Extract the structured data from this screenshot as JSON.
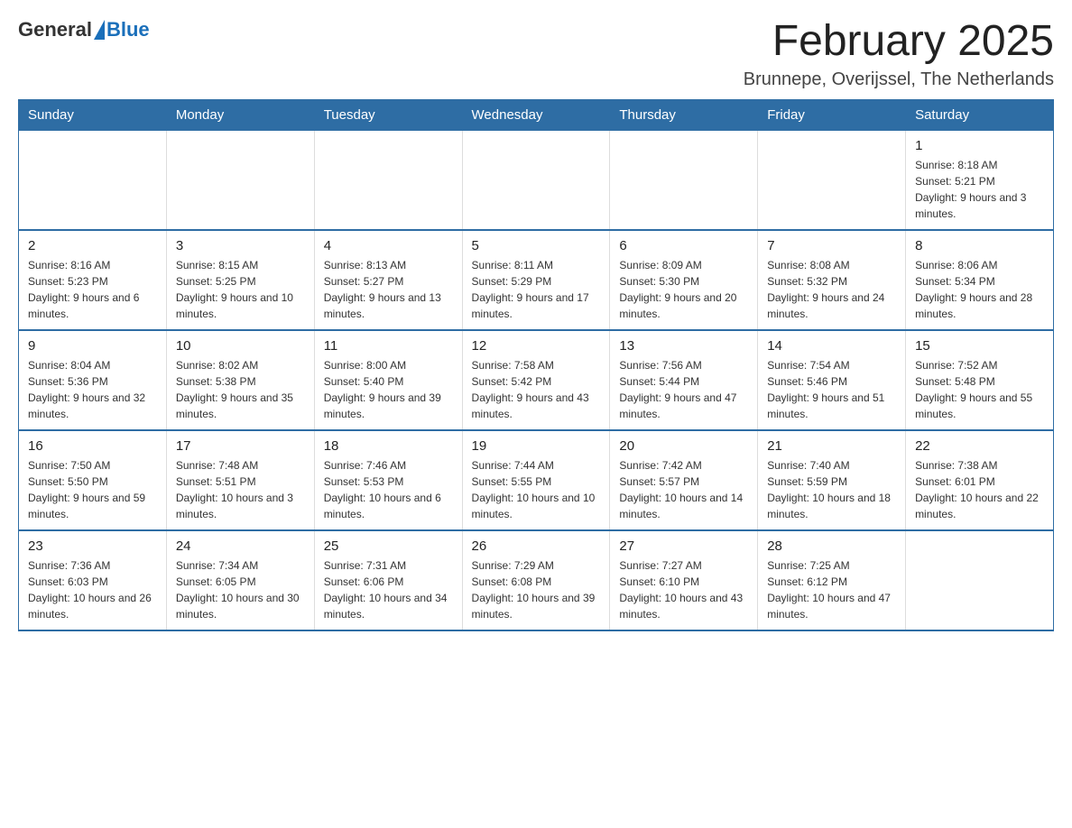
{
  "header": {
    "logo_general": "General",
    "logo_blue": "Blue",
    "month_title": "February 2025",
    "location": "Brunnepe, Overijssel, The Netherlands"
  },
  "weekdays": [
    "Sunday",
    "Monday",
    "Tuesday",
    "Wednesday",
    "Thursday",
    "Friday",
    "Saturday"
  ],
  "weeks": [
    [
      {
        "day": "",
        "sunrise": "",
        "sunset": "",
        "daylight": ""
      },
      {
        "day": "",
        "sunrise": "",
        "sunset": "",
        "daylight": ""
      },
      {
        "day": "",
        "sunrise": "",
        "sunset": "",
        "daylight": ""
      },
      {
        "day": "",
        "sunrise": "",
        "sunset": "",
        "daylight": ""
      },
      {
        "day": "",
        "sunrise": "",
        "sunset": "",
        "daylight": ""
      },
      {
        "day": "",
        "sunrise": "",
        "sunset": "",
        "daylight": ""
      },
      {
        "day": "1",
        "sunrise": "Sunrise: 8:18 AM",
        "sunset": "Sunset: 5:21 PM",
        "daylight": "Daylight: 9 hours and 3 minutes."
      }
    ],
    [
      {
        "day": "2",
        "sunrise": "Sunrise: 8:16 AM",
        "sunset": "Sunset: 5:23 PM",
        "daylight": "Daylight: 9 hours and 6 minutes."
      },
      {
        "day": "3",
        "sunrise": "Sunrise: 8:15 AM",
        "sunset": "Sunset: 5:25 PM",
        "daylight": "Daylight: 9 hours and 10 minutes."
      },
      {
        "day": "4",
        "sunrise": "Sunrise: 8:13 AM",
        "sunset": "Sunset: 5:27 PM",
        "daylight": "Daylight: 9 hours and 13 minutes."
      },
      {
        "day": "5",
        "sunrise": "Sunrise: 8:11 AM",
        "sunset": "Sunset: 5:29 PM",
        "daylight": "Daylight: 9 hours and 17 minutes."
      },
      {
        "day": "6",
        "sunrise": "Sunrise: 8:09 AM",
        "sunset": "Sunset: 5:30 PM",
        "daylight": "Daylight: 9 hours and 20 minutes."
      },
      {
        "day": "7",
        "sunrise": "Sunrise: 8:08 AM",
        "sunset": "Sunset: 5:32 PM",
        "daylight": "Daylight: 9 hours and 24 minutes."
      },
      {
        "day": "8",
        "sunrise": "Sunrise: 8:06 AM",
        "sunset": "Sunset: 5:34 PM",
        "daylight": "Daylight: 9 hours and 28 minutes."
      }
    ],
    [
      {
        "day": "9",
        "sunrise": "Sunrise: 8:04 AM",
        "sunset": "Sunset: 5:36 PM",
        "daylight": "Daylight: 9 hours and 32 minutes."
      },
      {
        "day": "10",
        "sunrise": "Sunrise: 8:02 AM",
        "sunset": "Sunset: 5:38 PM",
        "daylight": "Daylight: 9 hours and 35 minutes."
      },
      {
        "day": "11",
        "sunrise": "Sunrise: 8:00 AM",
        "sunset": "Sunset: 5:40 PM",
        "daylight": "Daylight: 9 hours and 39 minutes."
      },
      {
        "day": "12",
        "sunrise": "Sunrise: 7:58 AM",
        "sunset": "Sunset: 5:42 PM",
        "daylight": "Daylight: 9 hours and 43 minutes."
      },
      {
        "day": "13",
        "sunrise": "Sunrise: 7:56 AM",
        "sunset": "Sunset: 5:44 PM",
        "daylight": "Daylight: 9 hours and 47 minutes."
      },
      {
        "day": "14",
        "sunrise": "Sunrise: 7:54 AM",
        "sunset": "Sunset: 5:46 PM",
        "daylight": "Daylight: 9 hours and 51 minutes."
      },
      {
        "day": "15",
        "sunrise": "Sunrise: 7:52 AM",
        "sunset": "Sunset: 5:48 PM",
        "daylight": "Daylight: 9 hours and 55 minutes."
      }
    ],
    [
      {
        "day": "16",
        "sunrise": "Sunrise: 7:50 AM",
        "sunset": "Sunset: 5:50 PM",
        "daylight": "Daylight: 9 hours and 59 minutes."
      },
      {
        "day": "17",
        "sunrise": "Sunrise: 7:48 AM",
        "sunset": "Sunset: 5:51 PM",
        "daylight": "Daylight: 10 hours and 3 minutes."
      },
      {
        "day": "18",
        "sunrise": "Sunrise: 7:46 AM",
        "sunset": "Sunset: 5:53 PM",
        "daylight": "Daylight: 10 hours and 6 minutes."
      },
      {
        "day": "19",
        "sunrise": "Sunrise: 7:44 AM",
        "sunset": "Sunset: 5:55 PM",
        "daylight": "Daylight: 10 hours and 10 minutes."
      },
      {
        "day": "20",
        "sunrise": "Sunrise: 7:42 AM",
        "sunset": "Sunset: 5:57 PM",
        "daylight": "Daylight: 10 hours and 14 minutes."
      },
      {
        "day": "21",
        "sunrise": "Sunrise: 7:40 AM",
        "sunset": "Sunset: 5:59 PM",
        "daylight": "Daylight: 10 hours and 18 minutes."
      },
      {
        "day": "22",
        "sunrise": "Sunrise: 7:38 AM",
        "sunset": "Sunset: 6:01 PM",
        "daylight": "Daylight: 10 hours and 22 minutes."
      }
    ],
    [
      {
        "day": "23",
        "sunrise": "Sunrise: 7:36 AM",
        "sunset": "Sunset: 6:03 PM",
        "daylight": "Daylight: 10 hours and 26 minutes."
      },
      {
        "day": "24",
        "sunrise": "Sunrise: 7:34 AM",
        "sunset": "Sunset: 6:05 PM",
        "daylight": "Daylight: 10 hours and 30 minutes."
      },
      {
        "day": "25",
        "sunrise": "Sunrise: 7:31 AM",
        "sunset": "Sunset: 6:06 PM",
        "daylight": "Daylight: 10 hours and 34 minutes."
      },
      {
        "day": "26",
        "sunrise": "Sunrise: 7:29 AM",
        "sunset": "Sunset: 6:08 PM",
        "daylight": "Daylight: 10 hours and 39 minutes."
      },
      {
        "day": "27",
        "sunrise": "Sunrise: 7:27 AM",
        "sunset": "Sunset: 6:10 PM",
        "daylight": "Daylight: 10 hours and 43 minutes."
      },
      {
        "day": "28",
        "sunrise": "Sunrise: 7:25 AM",
        "sunset": "Sunset: 6:12 PM",
        "daylight": "Daylight: 10 hours and 47 minutes."
      },
      {
        "day": "",
        "sunrise": "",
        "sunset": "",
        "daylight": ""
      }
    ]
  ]
}
